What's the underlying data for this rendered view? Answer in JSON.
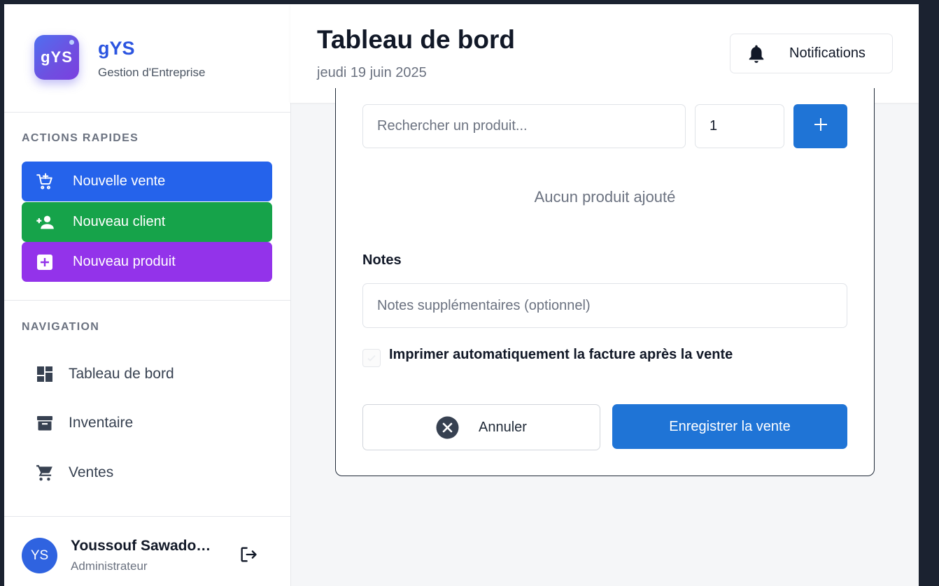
{
  "brand": {
    "logo_text": "gYS",
    "name": "gYS",
    "subtitle": "Gestion d'Entreprise"
  },
  "quick_actions": {
    "title": "ACTIONS RAPIDES",
    "items": [
      {
        "label": "Nouvelle vente",
        "icon": "add-shopping-cart-icon",
        "color": "#2563eb"
      },
      {
        "label": "Nouveau client",
        "icon": "person-add-icon",
        "color": "#16a34a"
      },
      {
        "label": "Nouveau produit",
        "icon": "add-box-icon",
        "color": "#9333ea"
      }
    ]
  },
  "navigation": {
    "title": "NAVIGATION",
    "items": [
      {
        "label": "Tableau de bord",
        "icon": "dashboard-icon"
      },
      {
        "label": "Inventaire",
        "icon": "archive-icon"
      },
      {
        "label": "Ventes",
        "icon": "cart-icon"
      }
    ]
  },
  "user": {
    "initials": "YS",
    "name": "Youssouf Sawado…",
    "role": "Administrateur"
  },
  "header": {
    "title": "Tableau de bord",
    "date": "jeudi 19 juin 2025",
    "notifications_label": "Notifications"
  },
  "sale_form": {
    "search_placeholder": "Rechercher un produit...",
    "quantity_value": "1",
    "add_label": "+",
    "empty_text": "Aucun produit ajouté",
    "notes_label": "Notes",
    "notes_placeholder": "Notes supplémentaires (optionnel)",
    "auto_print_label": "Imprimer automatiquement la facture après la vente",
    "auto_print_checked": false,
    "cancel_label": "Annuler",
    "save_label": "Enregistrer la vente"
  },
  "colors": {
    "primary": "#1f74d6",
    "brand": "#2c55e0"
  }
}
